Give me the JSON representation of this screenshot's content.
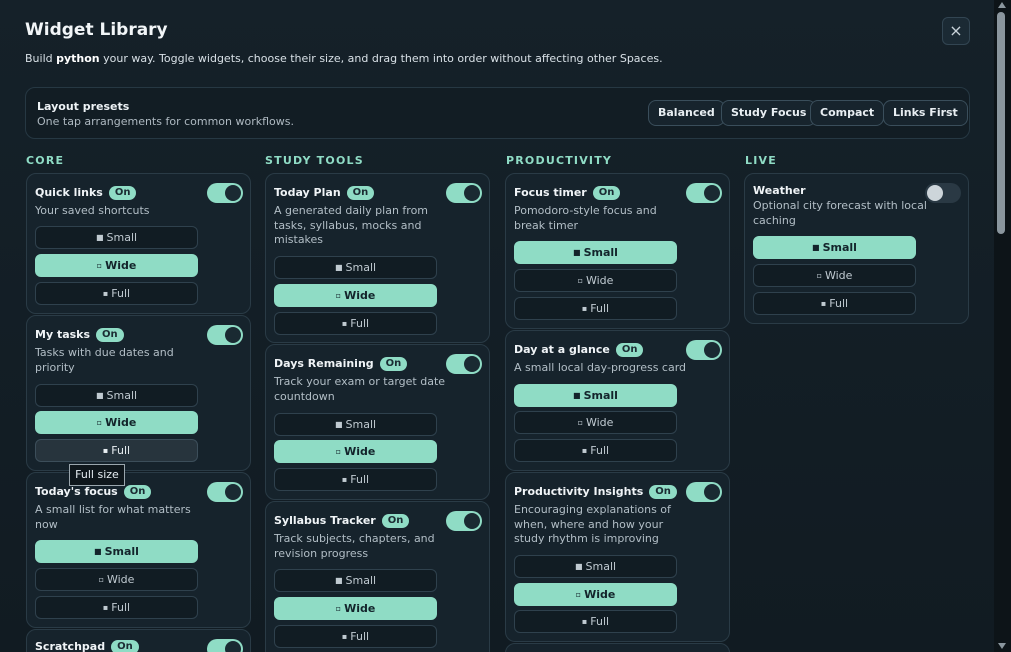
{
  "header": {
    "title": "Widget Library",
    "subtitle_pre": "Build ",
    "subtitle_bold": "python",
    "subtitle_post": " your way. Toggle widgets, choose their size, and drag them into order without affecting other Spaces.",
    "close_glyph": "×"
  },
  "presets": {
    "title": "Layout presets",
    "subtitle": "One tap arrangements for common workflows.",
    "buttons": [
      "Balanced",
      "Study Focus",
      "Compact",
      "Links First"
    ]
  },
  "sizes": {
    "small": "Small",
    "wide": "Wide",
    "full": "Full"
  },
  "size_glyphs": {
    "small": "■",
    "wide": "▫",
    "full": "▪"
  },
  "badge_on": "On",
  "tooltip": "Full size",
  "columns": [
    {
      "heading": "CORE",
      "cards": [
        {
          "name": "Quick links",
          "desc": "Your saved shortcuts",
          "on": true,
          "size": "wide"
        },
        {
          "name": "My tasks",
          "desc": "Tasks with due dates and priority",
          "on": true,
          "size": "wide"
        },
        {
          "name": "Today's focus",
          "desc": "A small list for what matters now",
          "on": true,
          "size": "small"
        },
        {
          "name": "Scratchpad",
          "desc": "",
          "on": true,
          "size": ""
        }
      ]
    },
    {
      "heading": "STUDY TOOLS",
      "cards": [
        {
          "name": "Today Plan",
          "desc": "A generated daily plan from tasks, syllabus, mocks and mistakes",
          "on": true,
          "size": "wide"
        },
        {
          "name": "Days Remaining",
          "desc": "Track your exam or target date countdown",
          "on": true,
          "size": "wide"
        },
        {
          "name": "Syllabus Tracker",
          "desc": "Track subjects, chapters, and revision progress",
          "on": true,
          "size": "wide"
        }
      ]
    },
    {
      "heading": "PRODUCTIVITY",
      "cards": [
        {
          "name": "Focus timer",
          "desc": "Pomodoro-style focus and break timer",
          "on": true,
          "size": "small"
        },
        {
          "name": "Day at a glance",
          "desc": "A small local day-progress card",
          "on": true,
          "size": "small"
        },
        {
          "name": "Productivity Insights",
          "desc": "Encouraging explanations of when, where and how your study rhythm is improving",
          "on": true,
          "size": "wide"
        }
      ]
    },
    {
      "heading": "LIVE",
      "cards": [
        {
          "name": "Weather",
          "desc": "Optional city forecast with local caching",
          "on": false,
          "size": "small"
        }
      ]
    }
  ],
  "colors": {
    "accent": "#8fdcc5",
    "background": "#15212a",
    "card": "#16232c"
  }
}
